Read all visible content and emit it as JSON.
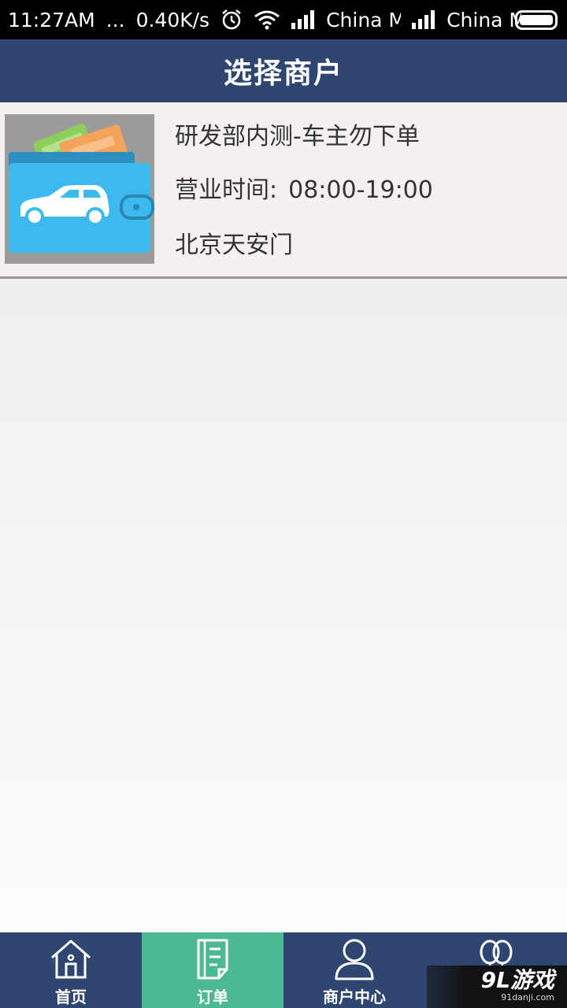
{
  "status_bar": {
    "time": "11:27AM",
    "dots": "...",
    "speed": "0.40K/s",
    "carrier1": "China M",
    "carrier2": "China M",
    "icons": [
      "alarm-icon",
      "wifi-icon",
      "signal-icon",
      "signal-icon",
      "battery-icon"
    ]
  },
  "header": {
    "title": "选择商户"
  },
  "merchants": [
    {
      "name": "研发部内测-车主勿下单",
      "hours_label": "营业时间:",
      "hours": "08:00-19:00",
      "address": "北京天安门",
      "thumb_icon": "wallet-car-icon"
    }
  ],
  "bottom_nav": {
    "items": [
      {
        "label": "首页",
        "icon": "home-icon",
        "active": false
      },
      {
        "label": "订单",
        "icon": "order-icon",
        "active": true
      },
      {
        "label": "商户中心",
        "icon": "person-icon",
        "active": false
      },
      {
        "label": "",
        "icon": "balloon-icon",
        "active": false
      }
    ]
  },
  "watermark": {
    "main": "9L游戏",
    "sub": "91danji.com"
  },
  "colors": {
    "header_bg": "#2e4670",
    "nav_active": "#4cb992",
    "row_bg": "#f3f0ef"
  }
}
